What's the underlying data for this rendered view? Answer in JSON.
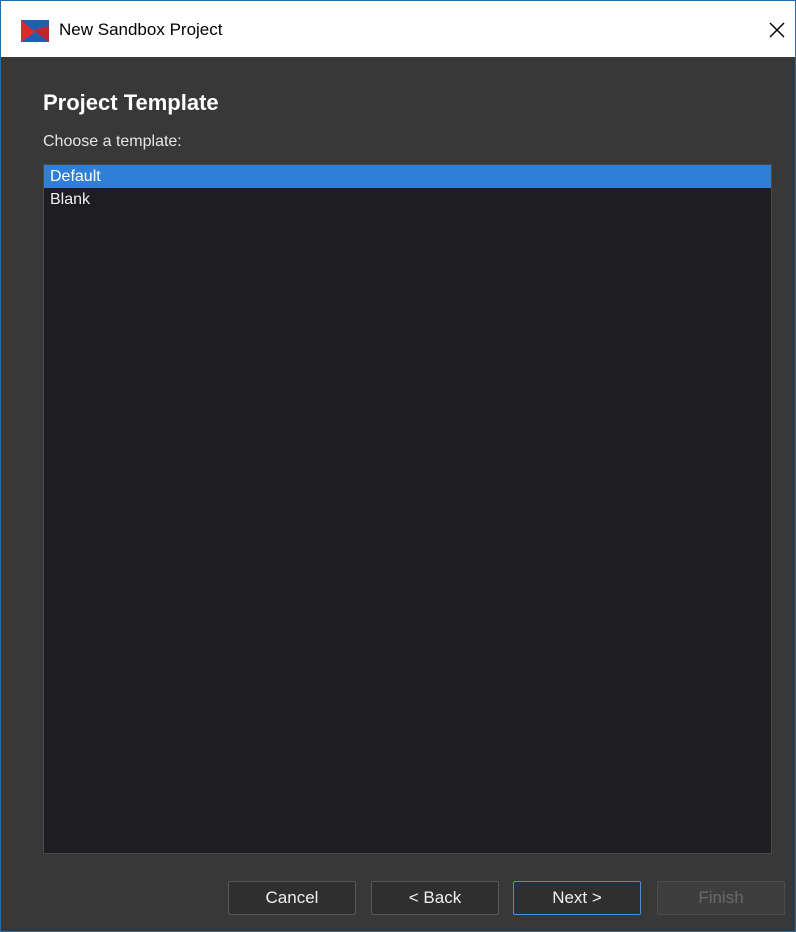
{
  "window": {
    "title": "New Sandbox Project",
    "close_glyph": "✕",
    "icon": "app-logo-icon"
  },
  "page": {
    "title": "Project Template",
    "subtitle": "Choose a template:"
  },
  "templates": {
    "items": [
      {
        "label": "Default",
        "selected": true
      },
      {
        "label": "Blank",
        "selected": false
      }
    ]
  },
  "buttons": {
    "cancel": "Cancel",
    "back": "< Back",
    "next": "Next >",
    "finish": "Finish"
  },
  "colors": {
    "selection": "#2f7fd6",
    "background": "#383838",
    "list_background": "#1e1e22"
  }
}
